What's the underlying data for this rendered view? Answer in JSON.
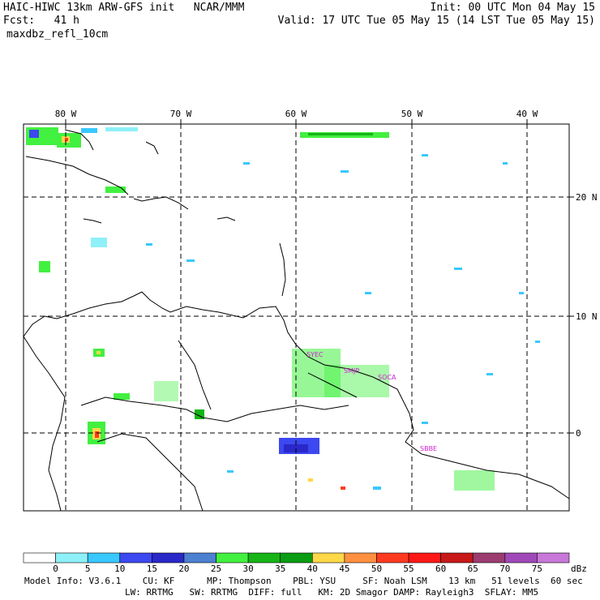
{
  "header": {
    "title": "HAIC-HIWC 13km ARW-GFS init   NCAR/MMM",
    "init": "Init: 00 UTC Mon 04 May 15",
    "fcst": "Fcst:   41 h",
    "valid": "Valid: 17 UTC Tue 05 May 15 (14 LST Tue 05 May 15)",
    "field": "maxdbz_refl_10cm"
  },
  "map": {
    "lon_labels": [
      "80 W",
      "70 W",
      "60 W",
      "50 W",
      "40 W"
    ],
    "lat_labels": [
      "20 N",
      "10 N",
      "0"
    ],
    "stations": [
      "SYEC",
      "SMJP",
      "SOCA",
      "SBBE"
    ]
  },
  "colorbar": {
    "levels": [
      "0",
      "5",
      "10",
      "15",
      "20",
      "25",
      "30",
      "35",
      "40",
      "45",
      "50",
      "55",
      "60",
      "65",
      "70",
      "75"
    ],
    "unit": "dBz",
    "colors": [
      "#ffffff",
      "#8ef0f8",
      "#39c8ff",
      "#3c48f0",
      "#2a28c8",
      "#4c80d0",
      "#42f040",
      "#16b416",
      "#0a9c12",
      "#ffd848",
      "#ff9040",
      "#ff3a20",
      "#ff1818",
      "#c81818",
      "#9c3c70",
      "#a048b8",
      "#c878d8"
    ]
  },
  "footer": {
    "line1": "Model Info: V3.6.1    CU: KF      MP: Thompson    PBL: YSU     SF: Noah LSM    13 km   51 levels  60 sec",
    "line2": "LW: RRTMG   SW: RRTMG  DIFF: full   KM: 2D Smagor DAMP: Rayleigh3  SFLAY: MM5"
  }
}
